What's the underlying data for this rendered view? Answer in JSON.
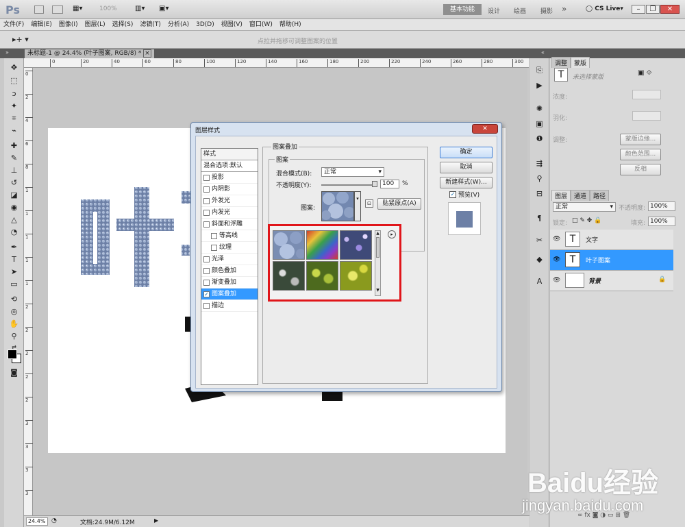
{
  "app": {
    "logo": "Ps",
    "zoom": "100%",
    "workspaces": [
      "基本功能",
      "设计",
      "绘画",
      "摄影"
    ],
    "more": "»",
    "cslive": "CS Live"
  },
  "menu": [
    "文件(F)",
    "编辑(E)",
    "图像(I)",
    "图层(L)",
    "选择(S)",
    "滤镜(T)",
    "分析(A)",
    "3D(D)",
    "视图(V)",
    "窗口(W)",
    "帮助(H)"
  ],
  "options": {
    "hint": "点拉并拖移可调整图案的位置"
  },
  "doc": {
    "tab": "未标题-1 @ 24.4% (叶子图案, RGB/8) *",
    "close": "×",
    "ruler_labels": [
      "0",
      "20",
      "40",
      "60",
      "80",
      "100",
      "120",
      "140",
      "160",
      "180",
      "200",
      "220",
      "240",
      "260",
      "280",
      "300"
    ],
    "ruler_v": [
      "0",
      "2",
      "4",
      "6",
      "8",
      "1",
      "1",
      "1",
      "1",
      "1",
      "2",
      "2",
      "2",
      "2",
      "2",
      "3",
      "3",
      "3",
      "3"
    ],
    "canvas_text_1": "叶",
    "canvas_text_2": "子"
  },
  "status": {
    "zoom": "24.4%",
    "doc": "文档:24.9M/6.12M"
  },
  "panels": {
    "tabs_top": [
      "调整",
      "蒙版"
    ],
    "mask_hint": "未选择蒙版",
    "density": "浓度:",
    "feather": "羽化:",
    "refine": "调整:",
    "mask_edge": "蒙版边缘...",
    "color_range": "颜色范围...",
    "invert": "反相",
    "layers_tabs": [
      "图层",
      "通道",
      "路径"
    ],
    "blend": "正常",
    "opacity_label": "不透明度:",
    "opacity": "100%",
    "lock_label": "锁定:",
    "fill_label": "填充:",
    "fill": "100%",
    "layers": [
      {
        "name": "文字",
        "type": "T",
        "selected": false
      },
      {
        "name": "叶子图案",
        "type": "T",
        "selected": true
      },
      {
        "name": "背景",
        "type": "bg",
        "selected": false
      }
    ]
  },
  "dialog": {
    "title": "图层样式",
    "close": "✕",
    "styles_header": "样式",
    "blend_default": "混合选项:默认",
    "effects": [
      {
        "label": "投影",
        "checked": false,
        "indent": false
      },
      {
        "label": "内阴影",
        "checked": false,
        "indent": false
      },
      {
        "label": "外发光",
        "checked": false,
        "indent": false
      },
      {
        "label": "内发光",
        "checked": false,
        "indent": false
      },
      {
        "label": "斜面和浮雕",
        "checked": false,
        "indent": false
      },
      {
        "label": "等高线",
        "checked": false,
        "indent": true
      },
      {
        "label": "纹理",
        "checked": false,
        "indent": true
      },
      {
        "label": "光泽",
        "checked": false,
        "indent": false
      },
      {
        "label": "颜色叠加",
        "checked": false,
        "indent": false
      },
      {
        "label": "渐变叠加",
        "checked": false,
        "indent": false
      },
      {
        "label": "图案叠加",
        "checked": true,
        "indent": false,
        "selected": true
      },
      {
        "label": "描边",
        "checked": false,
        "indent": false
      }
    ],
    "section": "图案叠加",
    "subsection": "图案",
    "blend_mode_label": "混合模式(B):",
    "blend_mode": "正常",
    "opacity_label": "不透明度(Y):",
    "opacity": "100",
    "pct": "%",
    "pattern_label": "图案:",
    "snap": "贴紧原点(A)",
    "ok": "确定",
    "cancel": "取消",
    "new_style": "新建样式(W)...",
    "preview": "预览(V)"
  },
  "watermark": {
    "brand": "Baidu经验",
    "url": "jingyan.baidu.com"
  },
  "colors": {
    "accent": "#3399ff",
    "highlight_box": "#e0151a"
  }
}
